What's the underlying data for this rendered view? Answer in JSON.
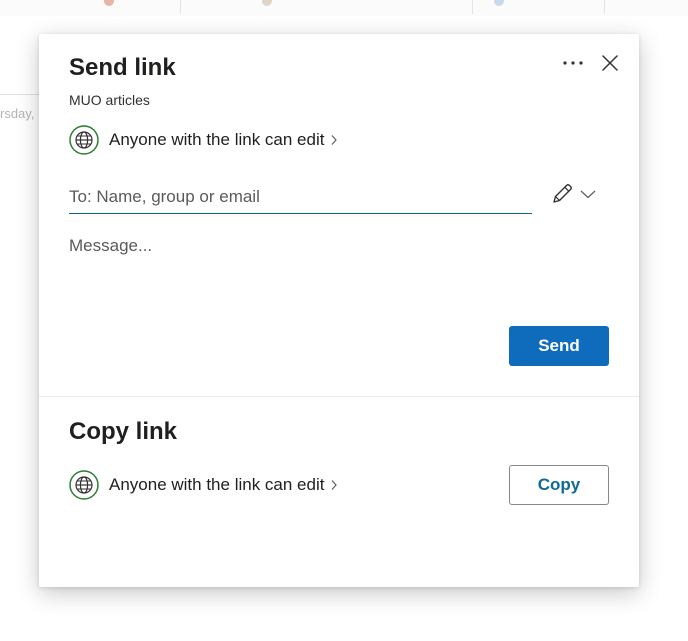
{
  "background": {
    "partial_day_label": "rsday,"
  },
  "dialog": {
    "title": "Send link",
    "subtitle": "MUO articles",
    "more_icon": "more-horizontal-icon",
    "close_icon": "close-icon",
    "send_section": {
      "permission_text": "Anyone with the link can edit",
      "permission_icon": "globe-icon",
      "to_placeholder": "To: Name, group or email",
      "to_value": "",
      "edit_icon": "pencil-icon",
      "message_placeholder": "Message...",
      "message_value": "",
      "send_label": "Send"
    },
    "copy_section": {
      "title": "Copy link",
      "permission_text": "Anyone with the link can edit",
      "copy_label": "Copy"
    }
  },
  "colors": {
    "primary": "#0f6cbd",
    "globe_green": "#2e7d32",
    "input_underline": "#0f6a7a"
  }
}
